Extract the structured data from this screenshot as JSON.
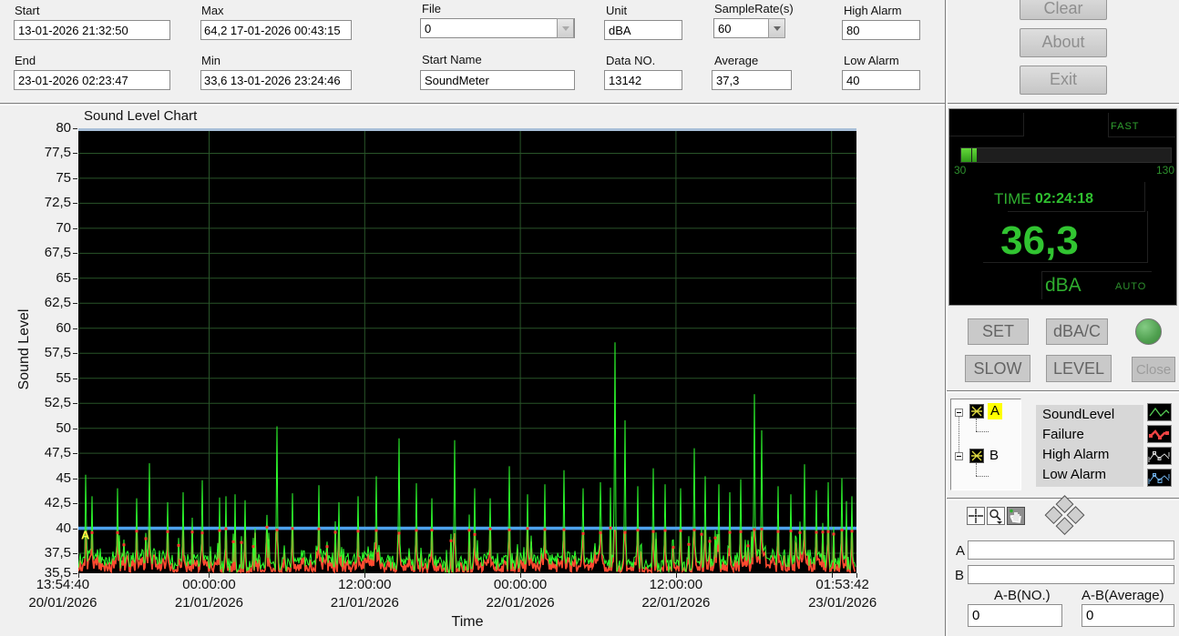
{
  "toolbar": {
    "fields": {
      "start": {
        "label": "Start",
        "value": "13-01-2026 21:32:50"
      },
      "end": {
        "label": "End",
        "value": "23-01-2026 02:23:47"
      },
      "max": {
        "label": "Max",
        "value": "64,2 17-01-2026 00:43:15"
      },
      "min": {
        "label": "Min",
        "value": "33,6 13-01-2026 23:24:46"
      },
      "file": {
        "label": "File",
        "value": "0"
      },
      "start_name": {
        "label": "Start Name",
        "value": "SoundMeter"
      },
      "unit": {
        "label": "Unit",
        "value": "dBA"
      },
      "data_no": {
        "label": "Data NO.",
        "value": "13142"
      },
      "sample_rate": {
        "label": "SampleRate(s)",
        "value": "60"
      },
      "average": {
        "label": "Average",
        "value": "37,3"
      },
      "high_alarm": {
        "label": "High Alarm",
        "value": "80"
      },
      "low_alarm": {
        "label": "Low Alarm",
        "value": "40"
      }
    },
    "buttons": {
      "clear": "Clear",
      "about": "About",
      "exit": "Exit"
    }
  },
  "chart_data": {
    "type": "line",
    "title": "Sound Level Chart",
    "xlabel": "Time",
    "ylabel": "Sound Level",
    "ylim": [
      35.5,
      80
    ],
    "plot_bg": "#000000",
    "grid": {
      "color": "#295429",
      "vertical_fracs": [
        0.168,
        0.368,
        0.568,
        0.768,
        0.968
      ]
    },
    "yticks": [
      {
        "label": "80",
        "value": 80
      },
      {
        "label": "77,5",
        "value": 77.5
      },
      {
        "label": "75",
        "value": 75
      },
      {
        "label": "72,5",
        "value": 72.5
      },
      {
        "label": "70",
        "value": 70
      },
      {
        "label": "67,5",
        "value": 67.5
      },
      {
        "label": "65",
        "value": 65
      },
      {
        "label": "62,5",
        "value": 62.5
      },
      {
        "label": "60",
        "value": 60
      },
      {
        "label": "57,5",
        "value": 57.5
      },
      {
        "label": "55",
        "value": 55
      },
      {
        "label": "52,5",
        "value": 52.5
      },
      {
        "label": "50",
        "value": 50
      },
      {
        "label": "47,5",
        "value": 47.5
      },
      {
        "label": "45",
        "value": 45
      },
      {
        "label": "42,5",
        "value": 42.5
      },
      {
        "label": "40",
        "value": 40
      },
      {
        "label": "37,5",
        "value": 37.5
      },
      {
        "label": "35,5",
        "value": 35.5
      }
    ],
    "xticks": [
      {
        "time": "13:54:40",
        "date": "20/01/2026",
        "frac": -0.02
      },
      {
        "time": "00:00:00",
        "date": "21/01/2026",
        "frac": 0.168
      },
      {
        "time": "12:00:00",
        "date": "21/01/2026",
        "frac": 0.368
      },
      {
        "time": "00:00:00",
        "date": "22/01/2026",
        "frac": 0.568
      },
      {
        "time": "12:00:00",
        "date": "22/01/2026",
        "frac": 0.768
      },
      {
        "time": "01:53:42",
        "date": "23/01/2026",
        "frac": 0.982
      }
    ],
    "tick_fracs": [
      0,
      0.168,
      0.368,
      0.568,
      0.768,
      0.968,
      1
    ],
    "seed": 20260123,
    "series": [
      {
        "name": "SoundLevel",
        "color": "#2dff2d",
        "baseline": [
          35.9,
          37.6
        ],
        "spike_rate": 0.022,
        "spike_max": 46.5,
        "peaks": [
          [
            0.018,
            43.2
          ],
          [
            0.05,
            44.0
          ],
          [
            0.075,
            43.0
          ],
          [
            0.091,
            46.5
          ],
          [
            0.115,
            42.6
          ],
          [
            0.135,
            43.6
          ],
          [
            0.16,
            44.8
          ],
          [
            0.19,
            43.2
          ],
          [
            0.215,
            42.8
          ],
          [
            0.256,
            50.2
          ],
          [
            0.275,
            43.5
          ],
          [
            0.31,
            44.3
          ],
          [
            0.335,
            42.6
          ],
          [
            0.36,
            43.2
          ],
          [
            0.383,
            45.2
          ],
          [
            0.413,
            49.0
          ],
          [
            0.435,
            44.5
          ],
          [
            0.455,
            43.0
          ],
          [
            0.484,
            48.8
          ],
          [
            0.51,
            44.0
          ],
          [
            0.53,
            43.0
          ],
          [
            0.555,
            46.2
          ],
          [
            0.578,
            43.4
          ],
          [
            0.6,
            44.4
          ],
          [
            0.625,
            45.8
          ],
          [
            0.65,
            44.0
          ],
          [
            0.672,
            44.6
          ],
          [
            0.69,
            58.6
          ],
          [
            0.703,
            50.8
          ],
          [
            0.72,
            44.2
          ],
          [
            0.74,
            46.0
          ],
          [
            0.755,
            44.4
          ],
          [
            0.775,
            44.0
          ],
          [
            0.793,
            48.0
          ],
          [
            0.806,
            45.2
          ],
          [
            0.824,
            44.4
          ],
          [
            0.838,
            43.6
          ],
          [
            0.852,
            44.9
          ],
          [
            0.87,
            53.4
          ],
          [
            0.879,
            49.8
          ],
          [
            0.9,
            44.2
          ],
          [
            0.917,
            43.4
          ],
          [
            0.934,
            46.4
          ],
          [
            0.95,
            43.8
          ],
          [
            0.965,
            44.6
          ],
          [
            0.982,
            45.0
          ],
          [
            0.995,
            43.2
          ]
        ]
      },
      {
        "name": "Failure",
        "color": "#ff4a30",
        "marker_color": "#ff3b28",
        "cap": 40.6,
        "offset": 0.45
      },
      {
        "name": "High Alarm",
        "color": "#a8bfd8",
        "value": 80
      },
      {
        "name": "Low Alarm",
        "color": "#4da2ec",
        "value": 40
      }
    ],
    "cursor": {
      "label": "A",
      "color": "#ffff44",
      "value": 38.9
    }
  },
  "meter": {
    "mode": "FAST",
    "scale_min": "30",
    "scale_max": "130",
    "time_label": "TIME",
    "time_value": "02:24:18",
    "reading": "36,3",
    "unit": "dBA",
    "range_mode": "AUTO",
    "buttons": {
      "set": "SET",
      "dbac": "dBA/C",
      "slow": "SLOW",
      "level": "LEVEL",
      "close": "Close"
    }
  },
  "legend": {
    "node_a": "A",
    "node_b": "B",
    "items": [
      {
        "label": "SoundLevel",
        "color": "#55cc55"
      },
      {
        "label": "Failure",
        "color": "#ee4444"
      },
      {
        "label": "High Alarm",
        "color": "#d4d4d4"
      },
      {
        "label": "Low Alarm",
        "color": "#6fb0e8"
      }
    ]
  },
  "cursor_panel": {
    "a_label": "A",
    "a_value": "",
    "b_label": "B",
    "b_value": "",
    "ab_no_label": "A-B(NO.)",
    "ab_no_value": "0",
    "ab_avg_label": "A-B(Average)",
    "ab_avg_value": "0"
  }
}
